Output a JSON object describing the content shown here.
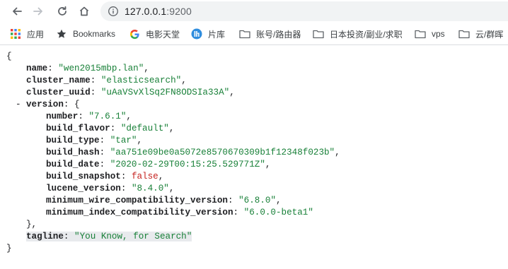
{
  "browser": {
    "url_host": "127.0.0.1",
    "url_port": ":9200",
    "icons": [
      "back-arrow-icon",
      "forward-arrow-icon",
      "reload-icon",
      "home-icon",
      "info-icon"
    ]
  },
  "bookmarks": [
    {
      "label": "应用",
      "icon": "apps-grid-icon"
    },
    {
      "label": "Bookmarks",
      "icon": "star-icon"
    },
    {
      "label": "电影天堂",
      "icon": "google-g-icon"
    },
    {
      "label": "片库",
      "icon": "pianku-icon"
    },
    {
      "label": "账号/路由器",
      "icon": "folder-icon"
    },
    {
      "label": "日本投资/副业/求职",
      "icon": "folder-icon"
    },
    {
      "label": "vps",
      "icon": "folder-icon"
    },
    {
      "label": "云/群晖",
      "icon": "folder-icon"
    }
  ],
  "json": {
    "open": "{",
    "close": "}",
    "name_key": "name",
    "name_val": "\"wen2015mbp.lan\"",
    "cluster_name_key": "cluster_name",
    "cluster_name_val": "\"elasticsearch\"",
    "cluster_uuid_key": "cluster_uuid",
    "cluster_uuid_val": "\"uAaVSvXlSq2FN8ODSIa33A\"",
    "collapse_marker": "-",
    "version_key": "version",
    "version_open": "{",
    "version_close": "},",
    "version": {
      "number_key": "number",
      "number_val": "\"7.6.1\"",
      "build_flavor_key": "build_flavor",
      "build_flavor_val": "\"default\"",
      "build_type_key": "build_type",
      "build_type_val": "\"tar\"",
      "build_hash_key": "build_hash",
      "build_hash_val": "\"aa751e09be0a5072e8570670309b1f12348f023b\"",
      "build_date_key": "build_date",
      "build_date_val": "\"2020-02-29T00:15:25.529771Z\"",
      "build_snapshot_key": "build_snapshot",
      "build_snapshot_val": "false",
      "lucene_version_key": "lucene_version",
      "lucene_version_val": "\"8.4.0\"",
      "min_wire_key": "minimum_wire_compatibility_version",
      "min_wire_val": "\"6.8.0\"",
      "min_index_key": "minimum_index_compatibility_version",
      "min_index_val": "\"6.0.0-beta1\""
    },
    "tagline_key": "tagline",
    "tagline_val": "\"You Know, for Search\""
  },
  "colors": {
    "key": "#202124",
    "string": "#188038",
    "boolean": "#c5221f",
    "highlight": "#e8eaed"
  }
}
